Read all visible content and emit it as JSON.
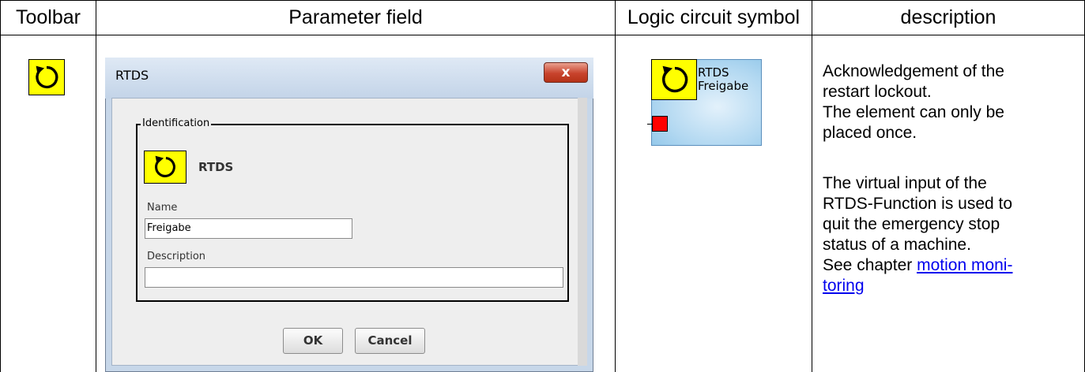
{
  "table": {
    "headers": {
      "toolbar": "Toolbar",
      "parameter_field": "Parameter field",
      "logic_symbol": "Logic circuit symbol",
      "description": "description"
    }
  },
  "toolbar_icon": "restart-icon",
  "dialog": {
    "title": "RTDS",
    "close_glyph": "x",
    "group_title": "Identification",
    "element_name": "RTDS",
    "name_label": "Name",
    "name_value": "Freigabe",
    "description_label": "Description",
    "description_value": "",
    "ok_label": "OK",
    "cancel_label": "Cancel"
  },
  "logic_symbol": {
    "line1": "RTDS",
    "line2": "Freigabe"
  },
  "description": {
    "para1_line1": "Acknowledgement of the",
    "para1_line2": "restart lockout.",
    "para1_line3": "The element can only be",
    "para1_line4": "placed once.",
    "para2_line1": "The virtual input of the",
    "para2_line2": "RTDS-Function is used to",
    "para2_line3": "quit the emergency stop",
    "para2_line4": "status of a machine.",
    "para2_line5_prefix": "See chapter ",
    "link_part1": "motion moni-",
    "link_part2": "toring"
  },
  "colors": {
    "icon_yellow": "#ffff00",
    "input_red": "#ff0000",
    "link_blue": "#0000ee"
  }
}
